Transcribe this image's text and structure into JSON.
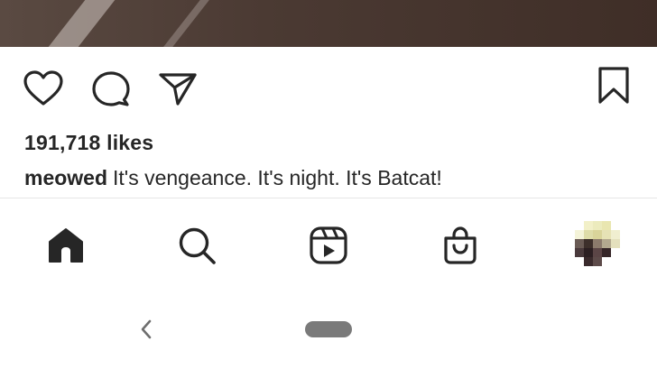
{
  "post": {
    "likes_text": "191,718 likes",
    "username": "meowed",
    "caption": "It's vengeance. It's night. It's Batcat!"
  },
  "actions": {
    "like_icon": "heart-icon",
    "comment_icon": "comment-icon",
    "share_icon": "send-icon",
    "save_icon": "bookmark-icon"
  },
  "bottom_nav": {
    "items": [
      {
        "icon": "home-icon"
      },
      {
        "icon": "search-icon"
      },
      {
        "icon": "reels-icon"
      },
      {
        "icon": "shop-icon"
      },
      {
        "icon": "profile-avatar"
      }
    ]
  },
  "system_nav": {
    "back_icon": "back-chevron-icon",
    "home_icon": "home-pill"
  },
  "colors": {
    "text": "#262626",
    "divider": "#e6e6e6",
    "background": "#ffffff"
  }
}
